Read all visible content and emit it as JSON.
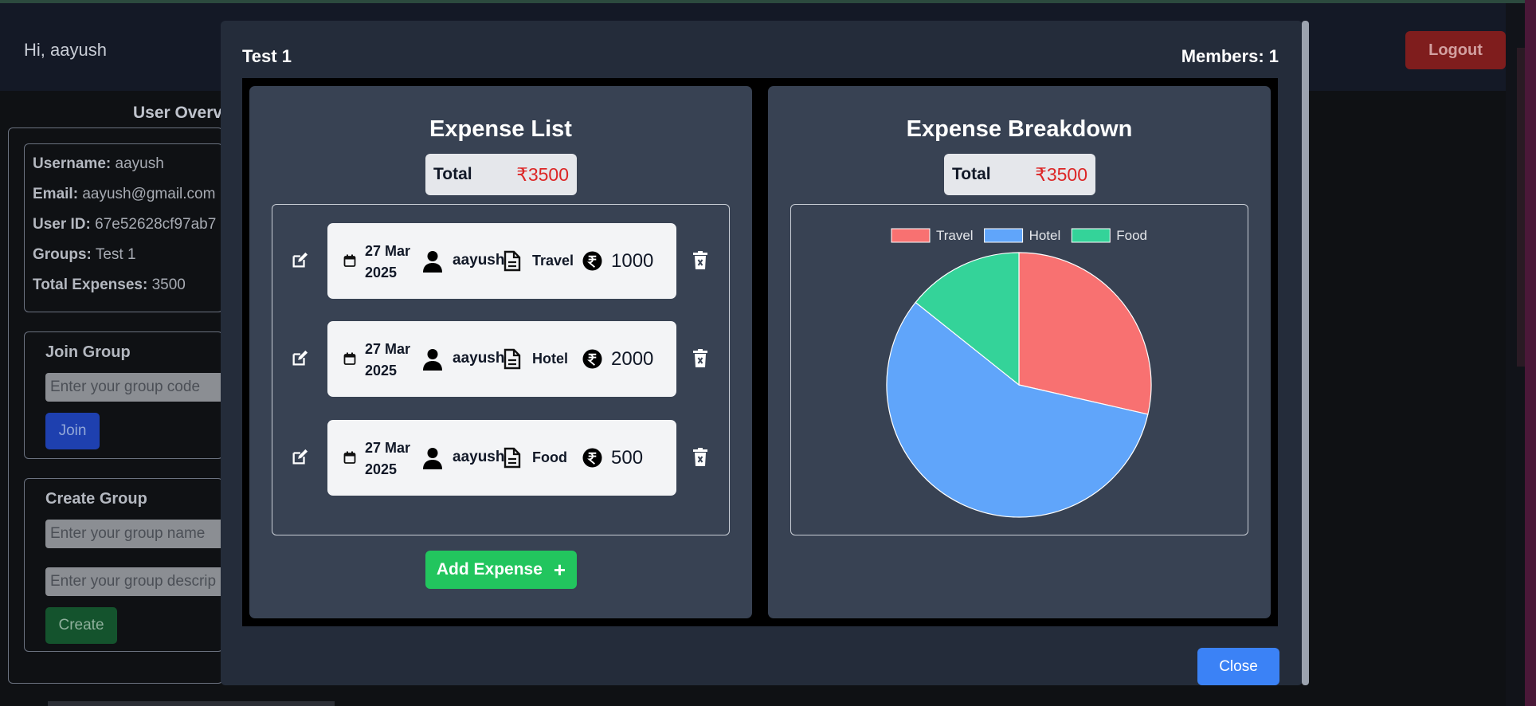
{
  "background": {
    "greeting": "Hi, aayush",
    "logout_label": "Logout",
    "overview_title": "User Overv",
    "info": [
      {
        "key": "Username:",
        "value": "aayush"
      },
      {
        "key": "Email:",
        "value": "aayush@gmail.com"
      },
      {
        "key": "User ID:",
        "value": "67e52628cf97ab7"
      },
      {
        "key": "Groups:",
        "value": "Test 1"
      },
      {
        "key": "Total Expenses:",
        "value": "3500"
      }
    ],
    "join": {
      "title": "Join Group",
      "placeholder": "Enter your group code",
      "button": "Join"
    },
    "create": {
      "title": "Create Group",
      "name_placeholder": "Enter your group name",
      "desc_placeholder": "Enter your group descrip",
      "button": "Create"
    }
  },
  "modal": {
    "group_name": "Test 1",
    "members": "Members: 1",
    "close_label": "Close",
    "expense_list": {
      "title": "Expense List",
      "total_label": "Total",
      "total_value": "₹3500",
      "add_label": "Add Expense",
      "add_plus": "+",
      "items": [
        {
          "date_line1": "27 Mar",
          "date_line2": "2025",
          "user": "aayush",
          "category": "Travel",
          "amount": "1000"
        },
        {
          "date_line1": "27 Mar",
          "date_line2": "2025",
          "user": "aayush",
          "category": "Hotel",
          "amount": "2000"
        },
        {
          "date_line1": "27 Mar",
          "date_line2": "2025",
          "user": "aayush",
          "category": "Food",
          "amount": "500"
        }
      ]
    },
    "breakdown": {
      "title": "Expense Breakdown",
      "total_label": "Total",
      "total_value": "₹3500"
    }
  },
  "chart_data": {
    "type": "pie",
    "categories": [
      "Travel",
      "Hotel",
      "Food"
    ],
    "values": [
      1000,
      2000,
      500
    ],
    "colors": [
      "#f87171",
      "#60a5fa",
      "#34d399"
    ],
    "legend": "top"
  }
}
